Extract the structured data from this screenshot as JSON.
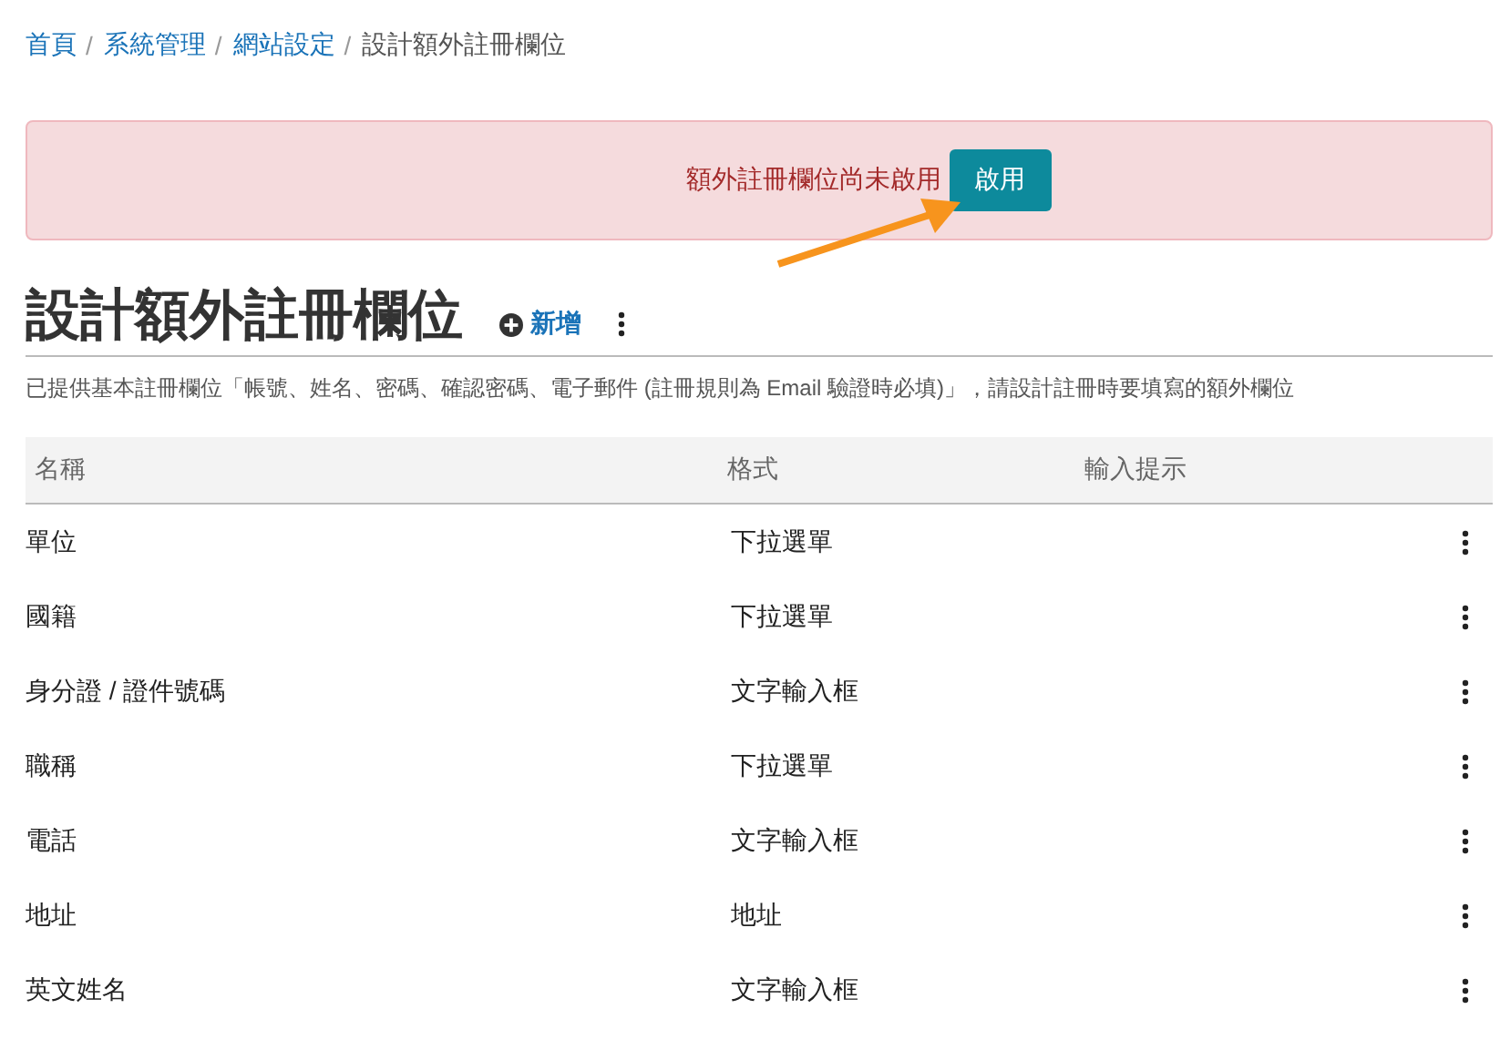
{
  "breadcrumb": {
    "items": [
      {
        "label": "首頁",
        "current": false
      },
      {
        "label": "系統管理",
        "current": false
      },
      {
        "label": "網站設定",
        "current": false
      },
      {
        "label": "設計額外註冊欄位",
        "current": true
      }
    ],
    "separators": [
      "/",
      "/",
      "/"
    ]
  },
  "alert": {
    "message": "額外註冊欄位尚未啟用",
    "button": "啟用"
  },
  "heading": {
    "title": "設計額外註冊欄位",
    "add_link": "新增"
  },
  "description": "已提供基本註冊欄位「帳號、姓名、密碼、確認密碼、電子郵件 (註冊規則為 Email 驗證時必填)」，請設計註冊時要填寫的額外欄位",
  "table": {
    "columns": [
      "名稱",
      "格式",
      "輸入提示"
    ],
    "rows": [
      {
        "name": "單位",
        "format": "下拉選單"
      },
      {
        "name": "國籍",
        "format": "下拉選單"
      },
      {
        "name": "身分證 / 證件號碼",
        "format": "文字輸入框"
      },
      {
        "name": "職稱",
        "format": "下拉選單"
      },
      {
        "name": "電話",
        "format": "文字輸入框"
      },
      {
        "name": "地址",
        "format": "地址"
      },
      {
        "name": "英文姓名",
        "format": "文字輸入框"
      }
    ]
  }
}
